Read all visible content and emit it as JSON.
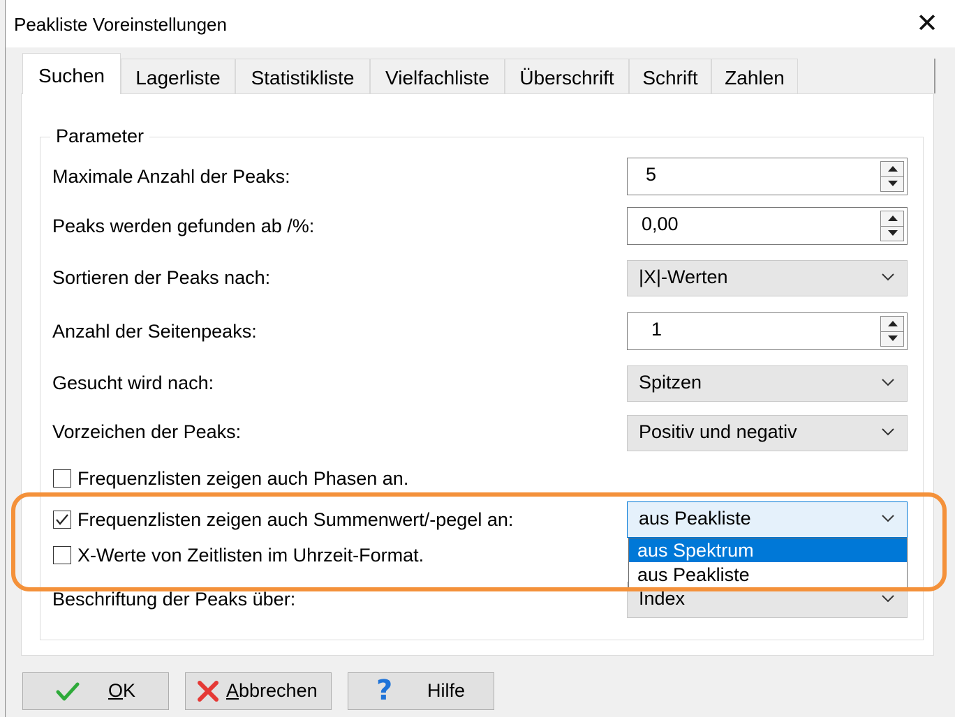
{
  "window": {
    "title": "Peakliste Voreinstellungen",
    "close_glyph": "✕"
  },
  "tabs": [
    {
      "label": "Suchen",
      "active": true
    },
    {
      "label": "Lagerliste"
    },
    {
      "label": "Statistikliste"
    },
    {
      "label": "Vielfachliste"
    },
    {
      "label": "Überschrift"
    },
    {
      "label": "Schrift"
    },
    {
      "label": "Zahlen"
    }
  ],
  "parameter": {
    "legend": "Parameter",
    "max_peaks": {
      "label": "Maximale Anzahl der Peaks:",
      "value": "5"
    },
    "found_from": {
      "label": "Peaks werden gefunden ab /%:",
      "value": "0,00"
    },
    "sort_by": {
      "label": "Sortieren der Peaks nach:",
      "value": "|X|-Werten"
    },
    "side_peaks": {
      "label": "Anzahl der Seitenpeaks:",
      "value": "1"
    },
    "search_for": {
      "label": "Gesucht wird nach:",
      "value": "Spitzen"
    },
    "sign": {
      "label": "Vorzeichen der Peaks:",
      "value": "Positiv und negativ"
    },
    "phases": {
      "label": "Frequenzlisten zeigen auch Phasen an.",
      "checked": false
    },
    "sum_value": {
      "label": "Frequenzlisten zeigen auch Summenwert/-pegel an:",
      "checked": true,
      "value": "aus Peakliste"
    },
    "clock_format": {
      "label": "X-Werte von Zeitlisten im Uhrzeit-Format.",
      "checked": false
    },
    "peak_caption": {
      "label": "Beschriftung der Peaks über:",
      "value": "Index"
    }
  },
  "dropdown_options": [
    {
      "label": "aus Spektrum",
      "selected": true
    },
    {
      "label": "aus Peakliste",
      "selected": false
    }
  ],
  "buttons": {
    "ok": {
      "label_first": "O",
      "label_rest": "K",
      "icon": "checkmark-icon"
    },
    "cancel": {
      "label_first": "A",
      "label_rest": "bbrechen",
      "icon": "x-icon"
    },
    "help": {
      "label": "Hilfe",
      "icon": "question-icon",
      "icon_glyph": "?"
    }
  },
  "colors": {
    "accent": "#0078d7",
    "highlight": "#f4913a",
    "ok_green": "#2eaa3a",
    "cancel_red": "#e53935",
    "help_blue": "#1e73d8"
  }
}
